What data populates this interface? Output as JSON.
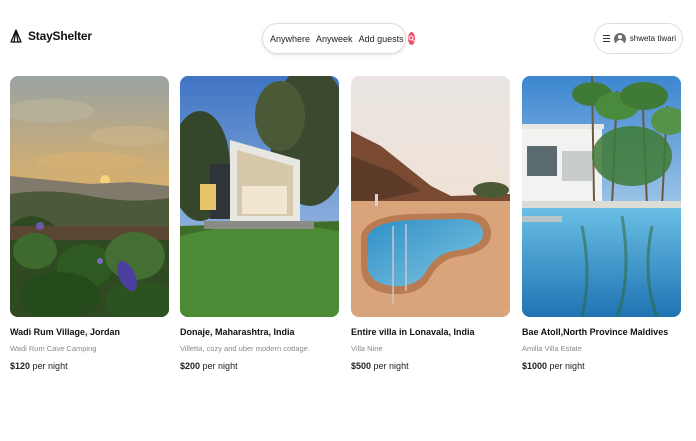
{
  "header": {
    "brand": "StayShelter",
    "search": {
      "where_label": "Anywhere",
      "when_label": "Anyweek",
      "guests_label": "Add guests"
    },
    "user": {
      "name": "shweta tiwari"
    }
  },
  "listings": [
    {
      "title": "Wadi Rum Village, Jordan",
      "subtitle": "Wadi Rum Cave Camping",
      "price": "$120",
      "price_suffix": "per night"
    },
    {
      "title": "Donaje, Maharashtra, India",
      "subtitle": "Villetta, cozy and uber modern cottage.",
      "price": "$200",
      "price_suffix": "per night"
    },
    {
      "title": "Entire villa in Lonavala, India",
      "subtitle": "Villa Nine",
      "price": "$500",
      "price_suffix": "per night"
    },
    {
      "title": "Bae Atoll,North Province Maldives",
      "subtitle": "Amilla Villa Estate",
      "price": "$1000",
      "price_suffix": "per night"
    }
  ],
  "colors": {
    "accent": "#f0506e"
  }
}
